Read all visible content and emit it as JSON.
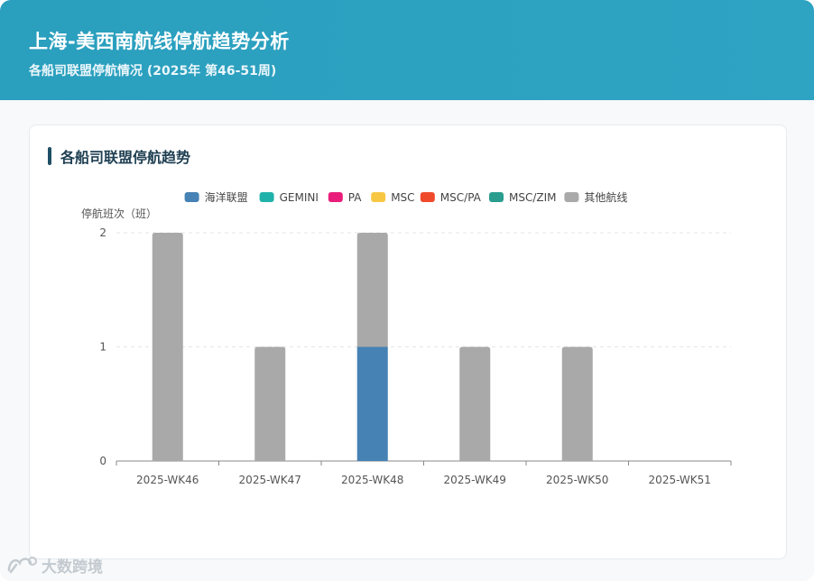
{
  "header": {
    "title": "上海-美西南航线停航趋势分析",
    "subtitle": "各船司联盟停航情况 (2025年 第46-51周)"
  },
  "card": {
    "title": "各船司联盟停航趋势"
  },
  "colors": {
    "header_bg": "#2aa0bf",
    "title_accent": "#1f4f66"
  },
  "watermark": {
    "text": "大数跨境",
    "icon": "brand-logo-icon"
  },
  "chart_data": {
    "type": "bar",
    "stacked": true,
    "ylabel": "停航班次（班）",
    "xlabel": "",
    "ylim": [
      0,
      2
    ],
    "yticks": [
      0,
      1,
      2
    ],
    "grid": true,
    "legend_position": "top-center",
    "categories": [
      "2025-WK46",
      "2025-WK47",
      "2025-WK48",
      "2025-WK49",
      "2025-WK50",
      "2025-WK51"
    ],
    "series": [
      {
        "name": "海洋联盟",
        "color": "#4682b4",
        "values": [
          0,
          0,
          1,
          0,
          0,
          0
        ]
      },
      {
        "name": "GEMINI",
        "color": "#20b2aa",
        "values": [
          0,
          0,
          0,
          0,
          0,
          0
        ]
      },
      {
        "name": "PA",
        "color": "#e91e7a",
        "values": [
          0,
          0,
          0,
          0,
          0,
          0
        ]
      },
      {
        "name": "MSC",
        "color": "#f7c744",
        "values": [
          0,
          0,
          0,
          0,
          0,
          0
        ]
      },
      {
        "name": "MSC/PA",
        "color": "#f04a2c",
        "values": [
          0,
          0,
          0,
          0,
          0,
          0
        ]
      },
      {
        "name": "MSC/ZIM",
        "color": "#2a9d8f",
        "values": [
          0,
          0,
          0,
          0,
          0,
          0
        ]
      },
      {
        "name": "其他航线",
        "color": "#a9a9a9",
        "values": [
          2,
          1,
          1,
          1,
          1,
          0
        ]
      }
    ]
  }
}
